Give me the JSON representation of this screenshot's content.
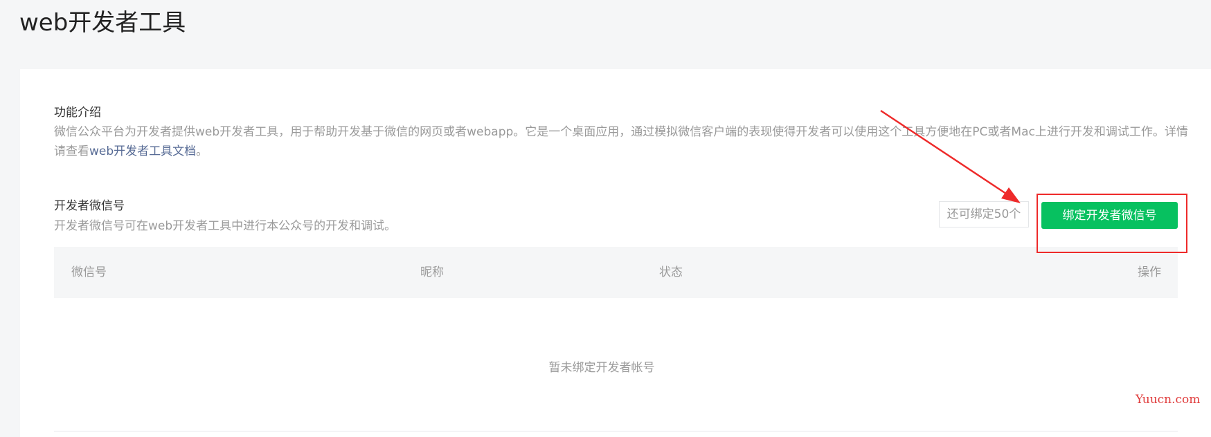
{
  "page": {
    "title": "web开发者工具"
  },
  "intro": {
    "title": "功能介绍",
    "desc_prefix": "微信公众平台为开发者提供web开发者工具，用于帮助开发基于微信的网页或者webapp。它是一个桌面应用，通过模拟微信客户端的表现使得开发者可以使用这个工具方便地在PC或者Mac上进行开发和调试工作。详情请查看",
    "doc_link": "web开发者工具文档",
    "desc_suffix": "。"
  },
  "developer": {
    "title": "开发者微信号",
    "desc": "开发者微信号可在web开发者工具中进行本公众号的开发和调试。",
    "remaining_label": "还可绑定50个",
    "bind_button": "绑定开发者微信号"
  },
  "table": {
    "columns": [
      "微信号",
      "昵称",
      "状态",
      "操作"
    ],
    "empty_text": "暂未绑定开发者帐号"
  },
  "watermark": "Yuucn.com",
  "colors": {
    "accent_green": "#07c160",
    "link": "#576b95",
    "annotation_red": "#ee2a2a"
  }
}
